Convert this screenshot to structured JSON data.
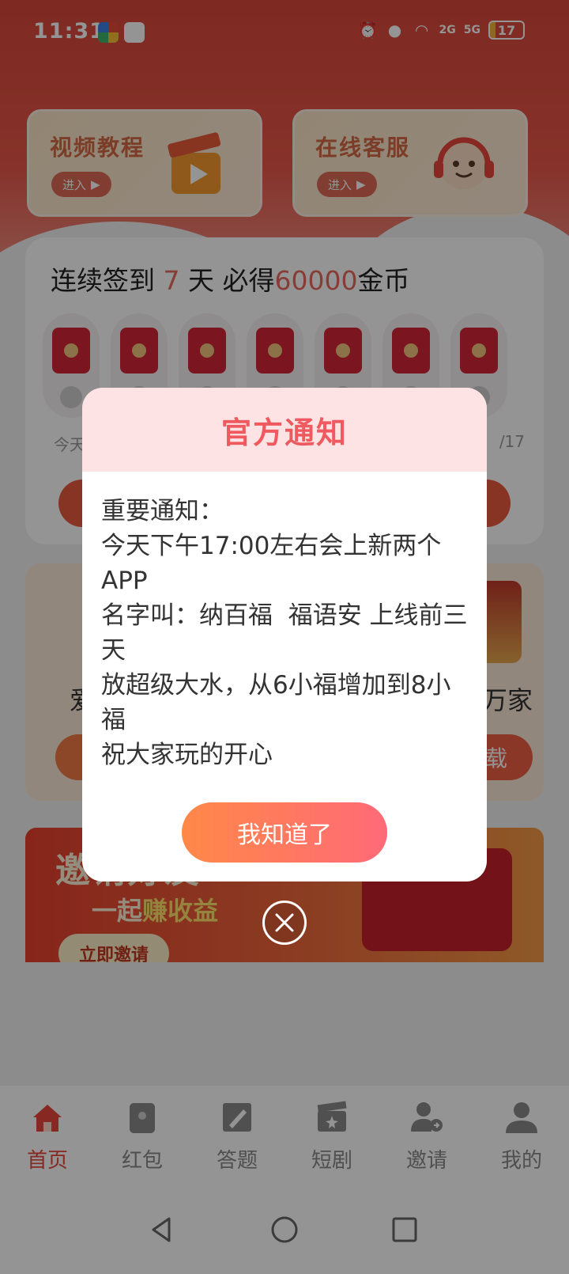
{
  "status_bar": {
    "time": "11:31",
    "battery": "17",
    "net2": "2G",
    "net5": "5G"
  },
  "quick_cards": [
    {
      "title": "视频教程",
      "button": "进入"
    },
    {
      "title": "在线客服",
      "button": "进入"
    }
  ],
  "signin": {
    "title_prefix": "连续签到",
    "title_days": "7",
    "title_mid": "天 必得",
    "title_amount": "60000",
    "title_suffix": "金币",
    "sub_left": "今天",
    "sub_right": "/17"
  },
  "promo": {
    "left_text": "爱",
    "right_text": "万家",
    "right_button": "下载"
  },
  "invite_banner": {
    "title": "邀请好友",
    "subtitle_prefix": "一起",
    "subtitle_highlight": "赚收益",
    "button": "立即邀请"
  },
  "bottom_nav": [
    {
      "label": "首页",
      "icon": "home-icon",
      "active": true
    },
    {
      "label": "红包",
      "icon": "red-envelope-icon",
      "active": false
    },
    {
      "label": "答题",
      "icon": "quiz-icon",
      "active": false
    },
    {
      "label": "短剧",
      "icon": "short-drama-icon",
      "active": false
    },
    {
      "label": "邀请",
      "icon": "invite-icon",
      "active": false
    },
    {
      "label": "我的",
      "icon": "profile-icon",
      "active": false
    }
  ],
  "dialog": {
    "title": "官方通知",
    "lines": [
      "重要通知：",
      "今天下午17:00左右会上新两个APP",
      "名字叫：纳百福  福语安 上线前三天",
      "放超级大水，从6小福增加到8小福",
      "祝大家玩的开心"
    ],
    "confirm_button": "我知道了"
  },
  "colors": {
    "accent": "#e8473b",
    "dialog_title": "#ee5a5f",
    "dialog_header_bg": "#fde3e4"
  }
}
